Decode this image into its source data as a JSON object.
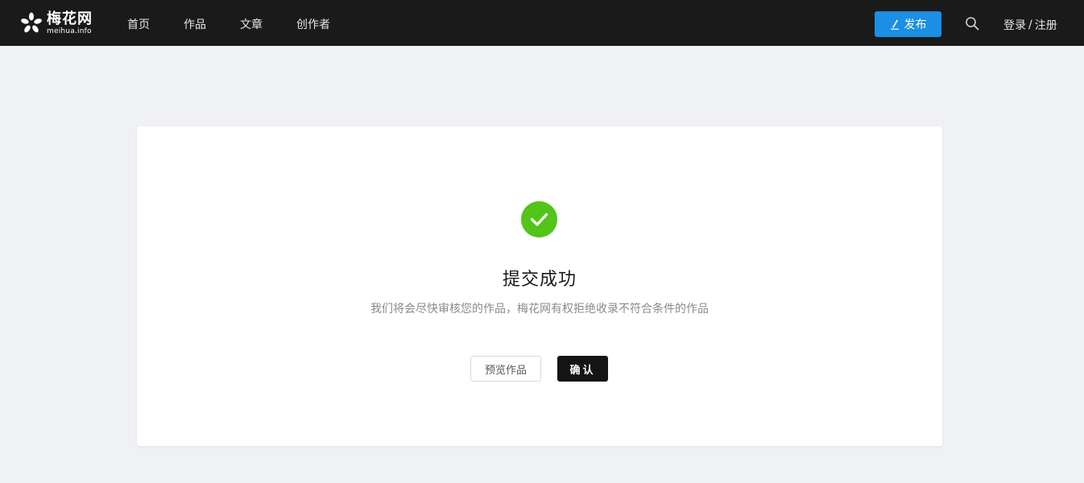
{
  "header": {
    "logo": {
      "cn": "梅花网",
      "en": "meihua.info"
    },
    "nav": [
      {
        "label": "首页"
      },
      {
        "label": "作品"
      },
      {
        "label": "文章"
      },
      {
        "label": "创作者"
      }
    ],
    "publish_label": "发布",
    "auth": {
      "login": "登录",
      "separator": "/",
      "register": "注册"
    }
  },
  "result": {
    "title": "提交成功",
    "description": "我们将会尽快审核您的作品，梅花网有权拒绝收录不符合条件的作品",
    "preview_label": "预览作品",
    "confirm_label": "确认"
  },
  "colors": {
    "topbar": "#1a1a1a",
    "accent": "#1a8fe3",
    "success": "#52c41a",
    "page_bg": "#f0f1f4"
  },
  "icons": {
    "logo": "flower-logo-icon",
    "publish": "pen-icon",
    "search": "search-icon",
    "success": "check-circle-icon"
  }
}
